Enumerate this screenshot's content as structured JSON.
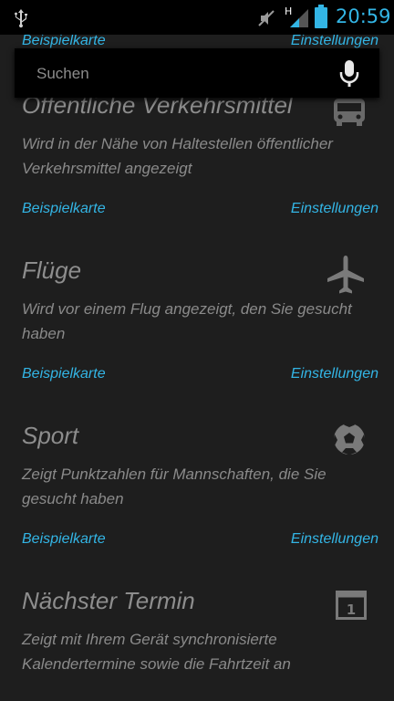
{
  "status_bar": {
    "time": "20:59",
    "network": "H",
    "icons": [
      "usb-icon",
      "mute-icon",
      "signal-icon",
      "battery-icon"
    ],
    "accent_color": "#33b5e5"
  },
  "search": {
    "placeholder": "Suchen",
    "icon": "microphone-icon"
  },
  "cards": [
    {
      "title": "",
      "description": "",
      "sample_link": "Beispielkarte",
      "settings_link": "Einstellungen"
    },
    {
      "title": "Öffentliche Verkehrsmittel",
      "description": "Wird in der Nähe von Haltestellen öffentlicher Verkehrsmittel angezeigt",
      "sample_link": "Beispielkarte",
      "settings_link": "Einstellungen",
      "icon": "bus-icon"
    },
    {
      "title": "Flüge",
      "description": "Wird vor einem Flug angezeigt, den Sie gesucht haben",
      "sample_link": "Beispielkarte",
      "settings_link": "Einstellungen",
      "icon": "airplane-icon"
    },
    {
      "title": "Sport",
      "description": "Zeigt Punktzahlen für Mannschaften, die Sie gesucht haben",
      "sample_link": "Beispielkarte",
      "settings_link": "Einstellungen",
      "icon": "soccer-ball-icon"
    },
    {
      "title": "Nächster Termin",
      "description": "Zeigt mit Ihrem Gerät synchronisierte Kalendertermine sowie die Fahrtzeit an",
      "icon": "calendar-icon",
      "icon_text": "1"
    }
  ]
}
